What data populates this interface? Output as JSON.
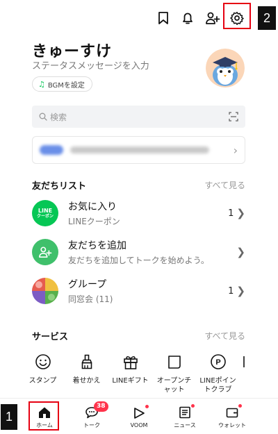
{
  "annotations": {
    "badge_settings": "2",
    "badge_home": "1"
  },
  "profile": {
    "name": "きゅーすけ",
    "status_placeholder": "ステータスメッセージを入力",
    "bgm_label": "BGMを設定"
  },
  "search": {
    "placeholder": "検索"
  },
  "friends": {
    "title": "友だちリスト",
    "see_all": "すべて見る",
    "items": [
      {
        "title": "お気に入り",
        "subtitle": "LINEクーポン",
        "count": "1",
        "icon_text_1": "LINE",
        "icon_text_2": "クーポン"
      },
      {
        "title": "友だちを追加",
        "subtitle": "友だちを追加してトークを始めよう。",
        "count": ""
      },
      {
        "title": "グループ",
        "subtitle": "同窓会 (11)",
        "count": "1"
      }
    ]
  },
  "services": {
    "title": "サービス",
    "see_all": "すべて見る",
    "items": [
      {
        "label": "スタンプ",
        "icon": "smile-icon"
      },
      {
        "label": "着せかえ",
        "icon": "brush-icon"
      },
      {
        "label": "LINEギフト",
        "icon": "gift-icon"
      },
      {
        "label": "オープンチ\nャット",
        "icon": "open-chat-icon"
      },
      {
        "label": "LINEポイン\nトクラブ",
        "icon": "points-icon"
      }
    ]
  },
  "tabs": [
    {
      "label": "ホーム",
      "icon": "home-icon",
      "active": true
    },
    {
      "label": "トーク",
      "icon": "chat-icon",
      "badge": "38"
    },
    {
      "label": "VOOM",
      "icon": "voom-icon"
    },
    {
      "label": "ニュース",
      "icon": "news-icon"
    },
    {
      "label": "ウォレット",
      "icon": "wallet-icon"
    }
  ],
  "colors": {
    "line_green": "#06c755",
    "highlight_red": "#e60012",
    "badge_red": "#ff334b"
  }
}
